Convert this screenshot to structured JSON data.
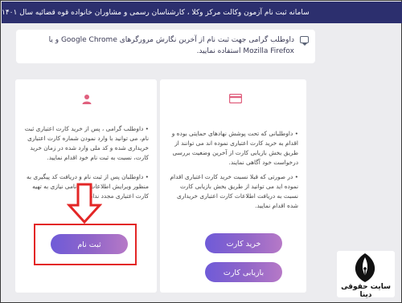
{
  "header": {
    "title": "سامانه ثبت نام آزمون وکالت مرکز وکلا ، کارشناسان رسمی و مشاوران خانواده قوه قضائیه سال ۱۴۰۱"
  },
  "notice": {
    "icon": "message-icon",
    "text": "داوطلب گرامی جهت ثبت نام از آخرین نگارش مرورگرهای Google Chrome و یا Mozilla Firefox استفاده نمایید."
  },
  "card_purchase": {
    "icon": "credit-card-icon",
    "paragraph_1": "• داوطلبانی که تحت پوشش نهادهای حمایتی بوده و اقدام به خرید کارت اعتباری نموده اند می توانند از طریق بخش بازیابی کارت از آخرین وضعیت بررسی درخواست خود آگاهی نمایند.",
    "paragraph_2": "• در صورتی که قبلا نسبت خرید کارت اعتباری اقدام نموده اید می توانید از طریق بخش بازیابی کارت نسبت به دریافت اطلاعات کارت اعتباری خریداری شده اقدام نمایید.",
    "buy_button": "خرید کارت",
    "recover_button": "بازیابی کارت"
  },
  "card_register": {
    "icon": "user-icon",
    "paragraph_1": "• داوطلب گرامی ، پس از خرید کارت اعتباری ثبت نام، می توانید با وارد نمودن شماره کارت اعتباری خریداری شده و کد ملی وارد شده در زمان خرید کارت، نسبت به ثبت نام خود اقدام نمایید.",
    "paragraph_2": "• داوطلبان پس از ثبت نام و دریافت کد پیگیری به منظور ویرایش اطلاعات ثبت نامی نیازی به تهیه کارت اعتباری مجدد ندارند.",
    "register_button": "ثبت نام"
  },
  "watermark": {
    "text": "سایت حقوقی دینا"
  },
  "colors": {
    "header_bg": "#2c2f6e",
    "accent_icon": "#e0607e",
    "button_gradient_start": "#6f5bd8",
    "button_gradient_end": "#b679c7",
    "highlight_red": "#e32626"
  }
}
